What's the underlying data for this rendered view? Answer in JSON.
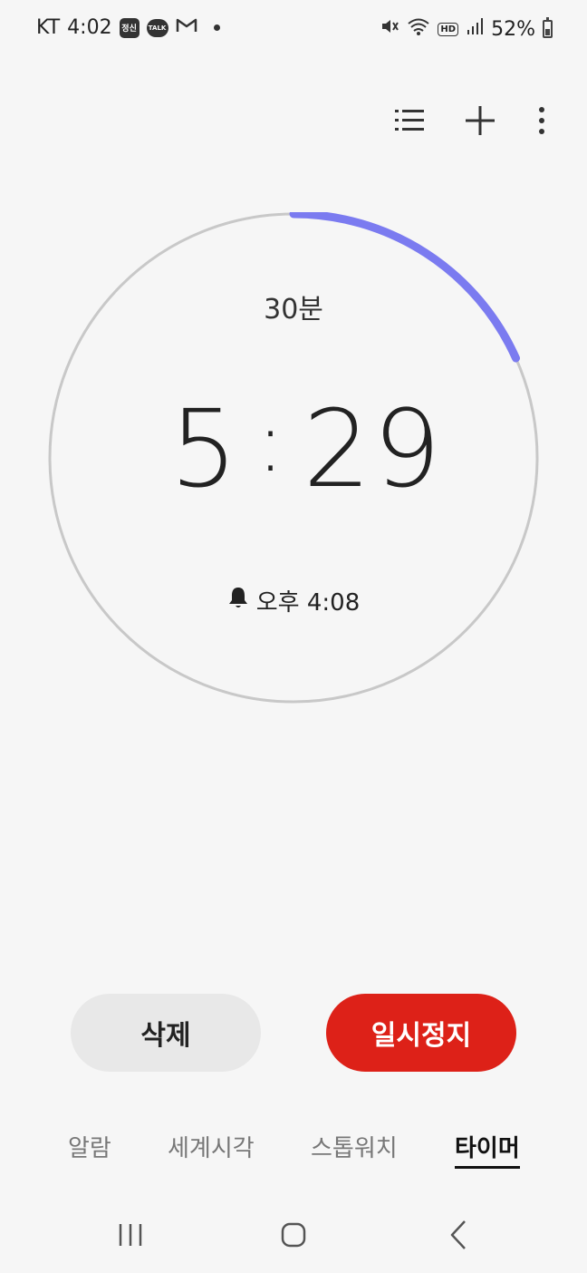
{
  "status_bar": {
    "carrier": "KT",
    "time": "4:02",
    "app_badge": "정신",
    "talk_badge": "TALK",
    "network_badge": "HD",
    "battery": "52%",
    "battery_level": 0.52
  },
  "timer": {
    "preset": "30분",
    "minutes": "5",
    "separator": ":",
    "seconds": "29",
    "end_time": "오후 4:08",
    "progress_fraction": 0.183,
    "ring_color": "#7b7bf0"
  },
  "buttons": {
    "delete": "삭제",
    "pause": "일시정지"
  },
  "tabs": {
    "alarm": "알람",
    "world_clock": "세계시각",
    "stopwatch": "스톱워치",
    "timer": "타이머"
  },
  "colors": {
    "pause_button": "#dd2118",
    "background": "#f6f6f6"
  },
  "icons": {
    "toolbar": [
      "list-icon",
      "plus-icon",
      "more-vertical-icon"
    ],
    "nav": [
      "recents-icon",
      "home-icon",
      "back-icon"
    ]
  }
}
